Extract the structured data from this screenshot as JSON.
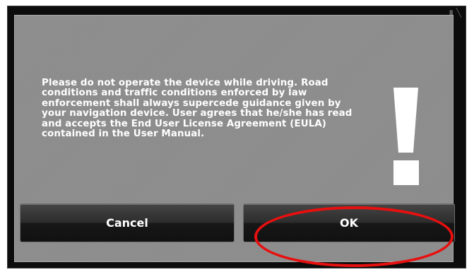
{
  "dialog": {
    "message": "Please do not operate the device while driving. Road conditions and traffic conditions enforced by law enforcement shall always supercede guidance given by your navigation device. User agrees that he/she has read and accepts the End User License Agreement (EULA) contained in the User Manual.",
    "icon": "exclamation-icon"
  },
  "buttons": {
    "cancel_label": "Cancel",
    "ok_label": "OK"
  },
  "annotation": {
    "highlight_color": "#e80f0f",
    "highlighted_element": "ok-button"
  },
  "colors": {
    "dialog_background": "#8c8c8c",
    "button_background": "#1e1e1e",
    "text": "#ffffff"
  }
}
